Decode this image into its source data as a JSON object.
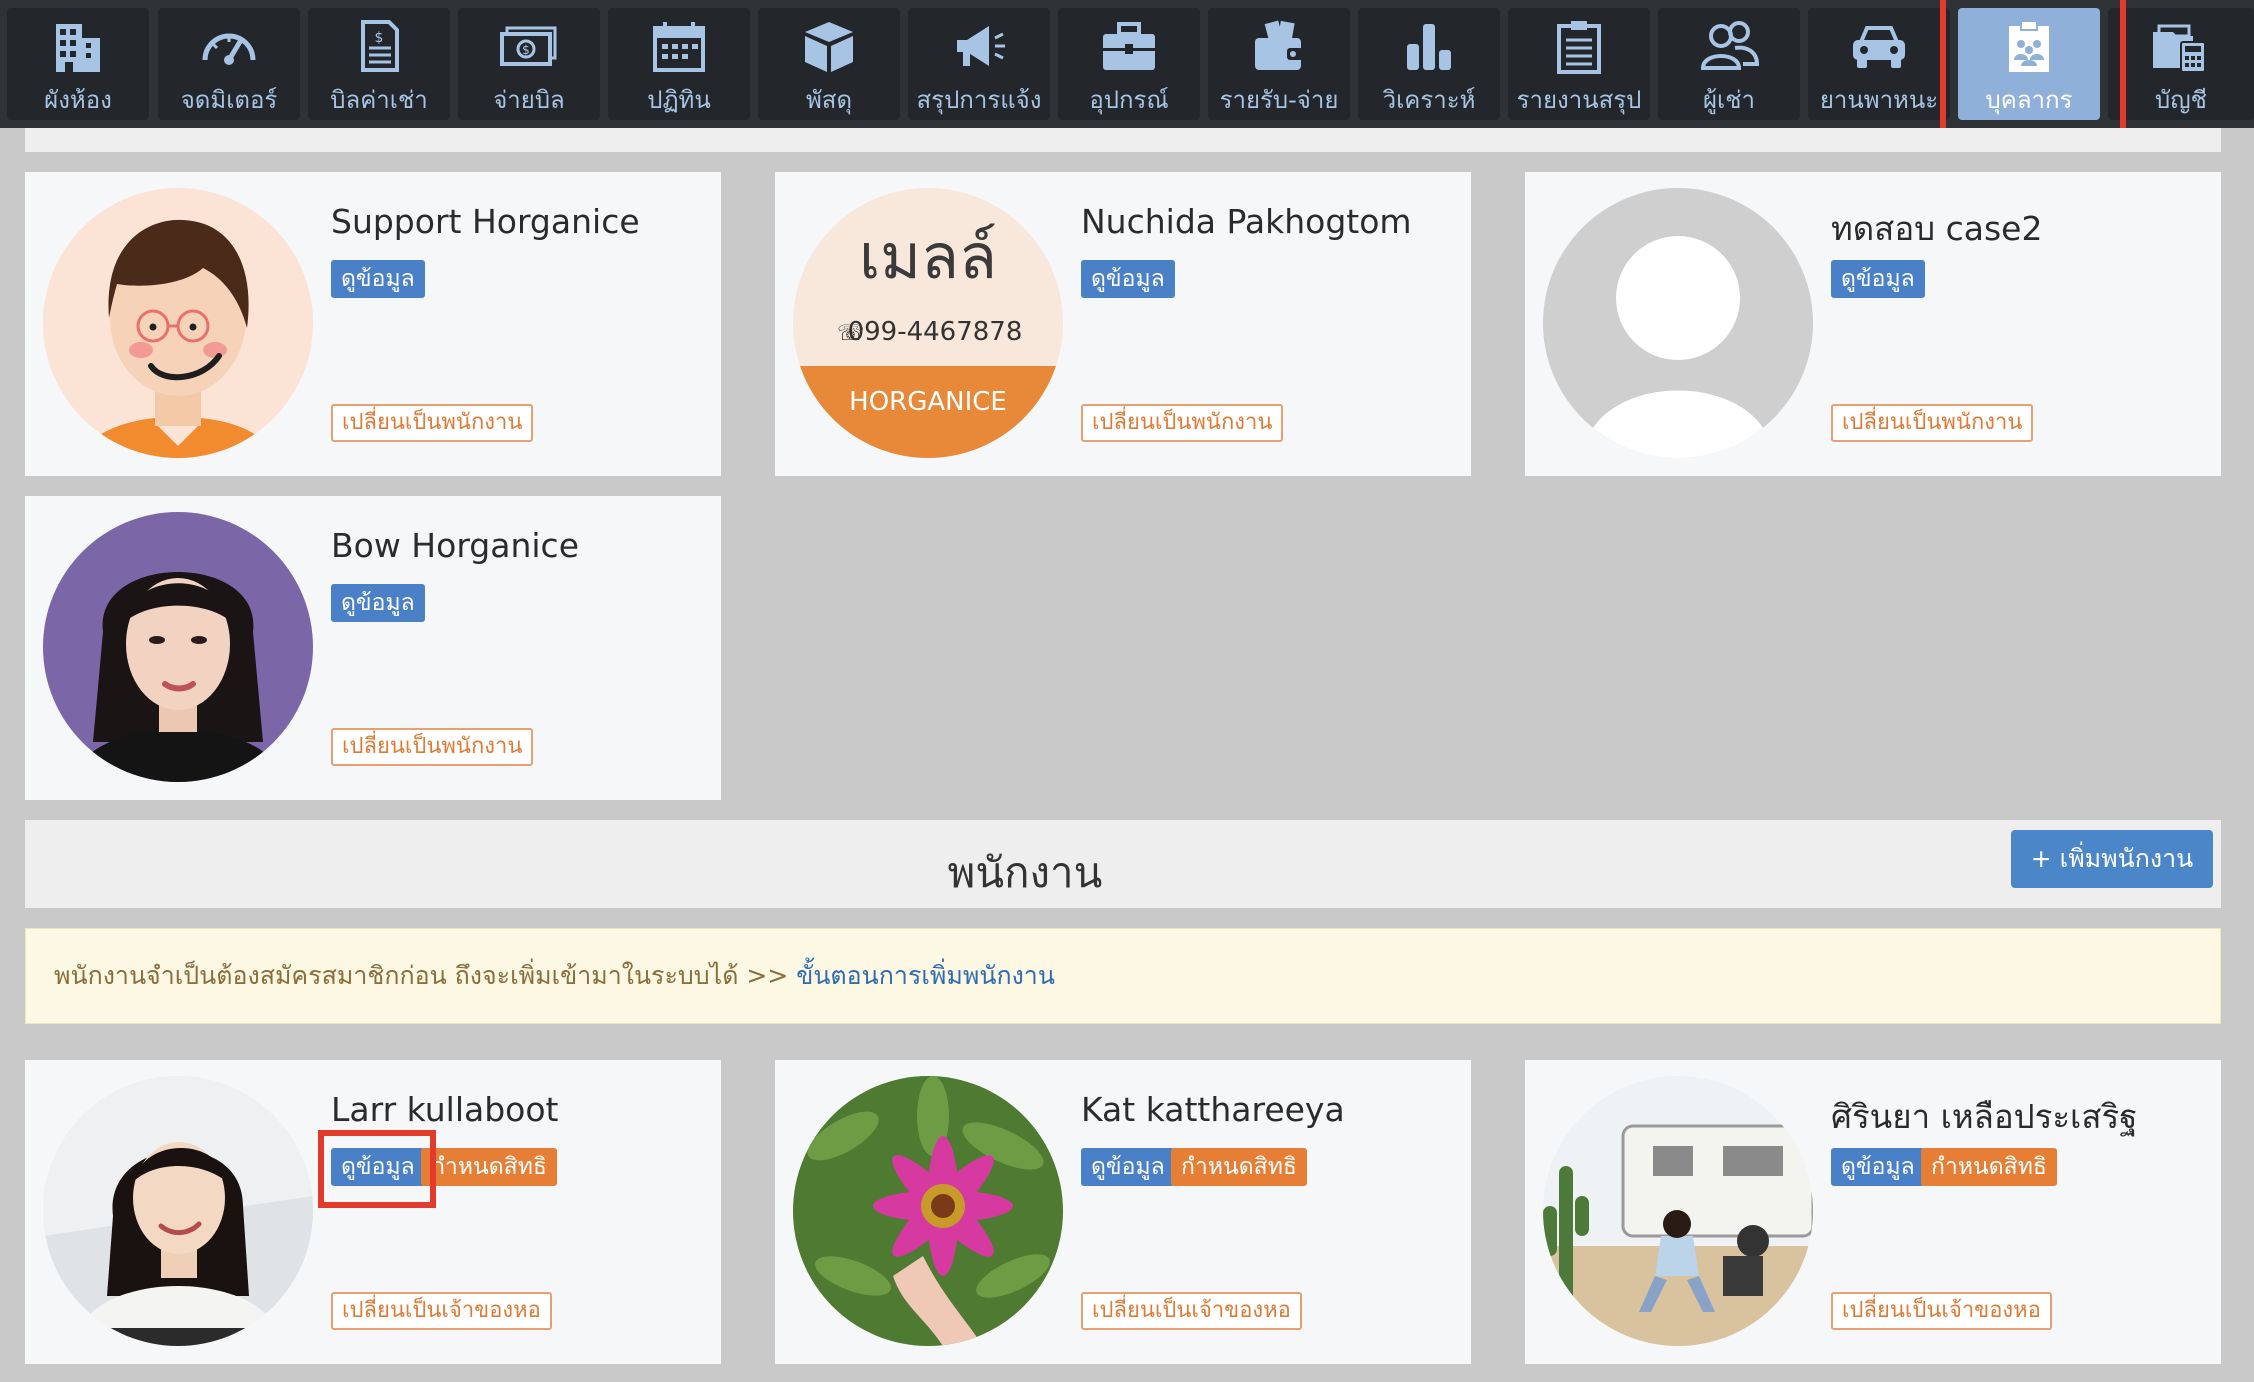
{
  "nav": {
    "items": [
      {
        "label": "ผังห้อง",
        "icon": "building-icon"
      },
      {
        "label": "จดมิเตอร์",
        "icon": "gauge-icon"
      },
      {
        "label": "บิลค่าเช่า",
        "icon": "invoice-icon"
      },
      {
        "label": "จ่ายบิล",
        "icon": "cash-icon"
      },
      {
        "label": "ปฏิทิน",
        "icon": "calendar-icon"
      },
      {
        "label": "พัสดุ",
        "icon": "package-icon"
      },
      {
        "label": "สรุปการแจ้ง",
        "icon": "megaphone-icon"
      },
      {
        "label": "อุปกรณ์",
        "icon": "toolbox-icon"
      },
      {
        "label": "รายรับ-จ่าย",
        "icon": "wallet-icon"
      },
      {
        "label": "วิเคราะห์",
        "icon": "bar-chart-icon"
      },
      {
        "label": "รายงานสรุป",
        "icon": "clipboard-list-icon"
      },
      {
        "label": "ผู้เช่า",
        "icon": "users-icon"
      },
      {
        "label": "ยานพาหนะ",
        "icon": "car-icon"
      },
      {
        "label": "บุคลากร",
        "icon": "staff-clipboard-icon",
        "active": true
      },
      {
        "label": "บัญชี",
        "icon": "accounting-icon"
      }
    ]
  },
  "owners": [
    {
      "name": "Support Horganice",
      "view_label": "ดูข้อมูล",
      "switch_label": "เปลี่ยนเป็นพนักงาน",
      "avatar": "cartoon-avatar"
    },
    {
      "name": "Nuchida Pakhogtom",
      "view_label": "ดูข้อมูล",
      "switch_label": "เปลี่ยนเป็นพนักงาน",
      "avatar": "logo-avatar",
      "logo_title": "เมลล์",
      "logo_phone": "099-4467878",
      "logo_brand": "HORGANICE"
    },
    {
      "name": "ทดสอบ case2",
      "view_label": "ดูข้อมูล",
      "switch_label": "เปลี่ยนเป็นพนักงาน",
      "avatar": "default-avatar"
    },
    {
      "name": "Bow Horganice",
      "view_label": "ดูข้อมูล",
      "switch_label": "เปลี่ยนเป็นพนักงาน",
      "avatar": "portrait-avatar"
    }
  ],
  "staff_section": {
    "title": "พนักงาน",
    "add_button": "+ เพิ่มพนักงาน",
    "notice_text": "พนักงานจำเป็นต้องสมัครสมาชิกก่อน ถึงจะเพิ่มเข้ามาในระบบได้ >> ",
    "notice_link": "ขั้นตอนการเพิ่มพนักงาน"
  },
  "staff": [
    {
      "name": "Larr kullaboot",
      "view_label": "ดูข้อมูล",
      "perm_label": "กำหนดสิทธิ",
      "switch_label": "เปลี่ยนเป็นเจ้าของหอ",
      "avatar": "photo-avatar"
    },
    {
      "name": "Kat katthareeya",
      "view_label": "ดูข้อมูล",
      "perm_label": "กำหนดสิทธิ",
      "switch_label": "เปลี่ยนเป็นเจ้าของหอ",
      "avatar": "flower-avatar"
    },
    {
      "name": "ศิรินยา เหลือประเสริฐ",
      "view_label": "ดูข้อมูล",
      "perm_label": "กำหนดสิทธิ",
      "switch_label": "เปลี่ยนเป็นเจ้าของหอ",
      "avatar": "outdoor-avatar"
    }
  ],
  "colors": {
    "nav_bg": "#2f3338",
    "nav_item_bg": "#23272b",
    "nav_active": "#8fb0d9",
    "primary_button": "#4a80c8",
    "permission_button": "#e67f35",
    "highlight_box": "#e23a2b",
    "notice_bg": "#fcf8e3"
  }
}
